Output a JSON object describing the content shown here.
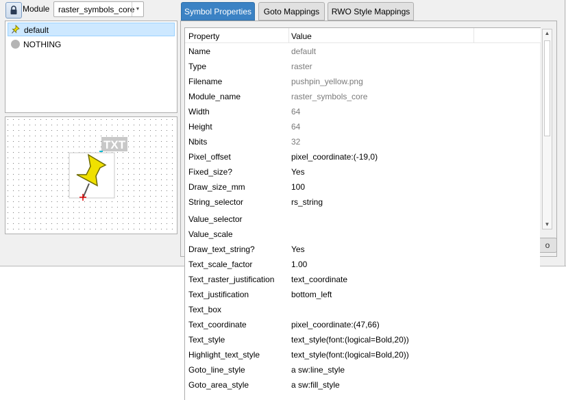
{
  "toolbar": {
    "module_label": "Module",
    "module_value": "raster_symbols_core"
  },
  "symbols": [
    {
      "label": "default",
      "icon": "pushpin-icon",
      "selected": true
    },
    {
      "label": "NOTHING",
      "icon": "grey-circle-icon",
      "selected": false
    }
  ],
  "preview": {
    "text_label": "TXT",
    "pin_color": "#f0e000"
  },
  "tabs": [
    {
      "label": "Symbol Properties",
      "active": true
    },
    {
      "label": "Goto Mappings",
      "active": false
    },
    {
      "label": "RWO Style Mappings",
      "active": false
    }
  ],
  "table": {
    "headers": [
      "Property",
      "Value"
    ],
    "rows": [
      {
        "name": "Name",
        "value": "default",
        "muted": true
      },
      {
        "name": "Type",
        "value": "raster",
        "muted": true
      },
      {
        "name": "Filename",
        "value": "pushpin_yellow.png",
        "muted": true
      },
      {
        "name": "Module_name",
        "value": "raster_symbols_core",
        "muted": true
      },
      {
        "name": "Width",
        "value": "64",
        "muted": true
      },
      {
        "name": "Height",
        "value": "64",
        "muted": true
      },
      {
        "name": "Nbits",
        "value": "32",
        "muted": true
      },
      {
        "name": "Pixel_offset",
        "value": "pixel_coordinate:(-19,0)",
        "muted": false
      },
      {
        "name": "Fixed_size?",
        "value": "Yes",
        "muted": false
      },
      {
        "name": "Draw_size_mm",
        "value": "100",
        "muted": false
      },
      {
        "name": "String_selector",
        "value": "rs_string",
        "muted": false
      },
      {
        "name": "Value_selector",
        "value": "",
        "muted": false
      },
      {
        "name": "Value_scale",
        "value": "",
        "muted": false
      },
      {
        "name": "Draw_text_string?",
        "value": "Yes",
        "muted": false
      },
      {
        "name": "Text_scale_factor",
        "value": "1.00",
        "muted": false
      },
      {
        "name": "Text_raster_justification",
        "value": "text_coordinate",
        "muted": false
      },
      {
        "name": "Text_justification",
        "value": "bottom_left",
        "muted": false
      },
      {
        "name": "Text_box",
        "value": "",
        "muted": false
      },
      {
        "name": "Text_coordinate",
        "value": "pixel_coordinate:(47,66)",
        "muted": false
      },
      {
        "name": "Text_style",
        "value": "text_style(font:(logical=Bold,20))",
        "muted": false
      },
      {
        "name": "Highlight_text_style",
        "value": "text_style(font:(logical=Bold,20))",
        "muted": false
      },
      {
        "name": "Goto_line_style",
        "value": "a sw:line_style",
        "muted": false
      },
      {
        "name": "Goto_area_style",
        "value": "a sw:fill_style",
        "muted": false
      }
    ]
  },
  "colors": {
    "accent": "#3b82c4",
    "selection": "#cde8ff"
  }
}
